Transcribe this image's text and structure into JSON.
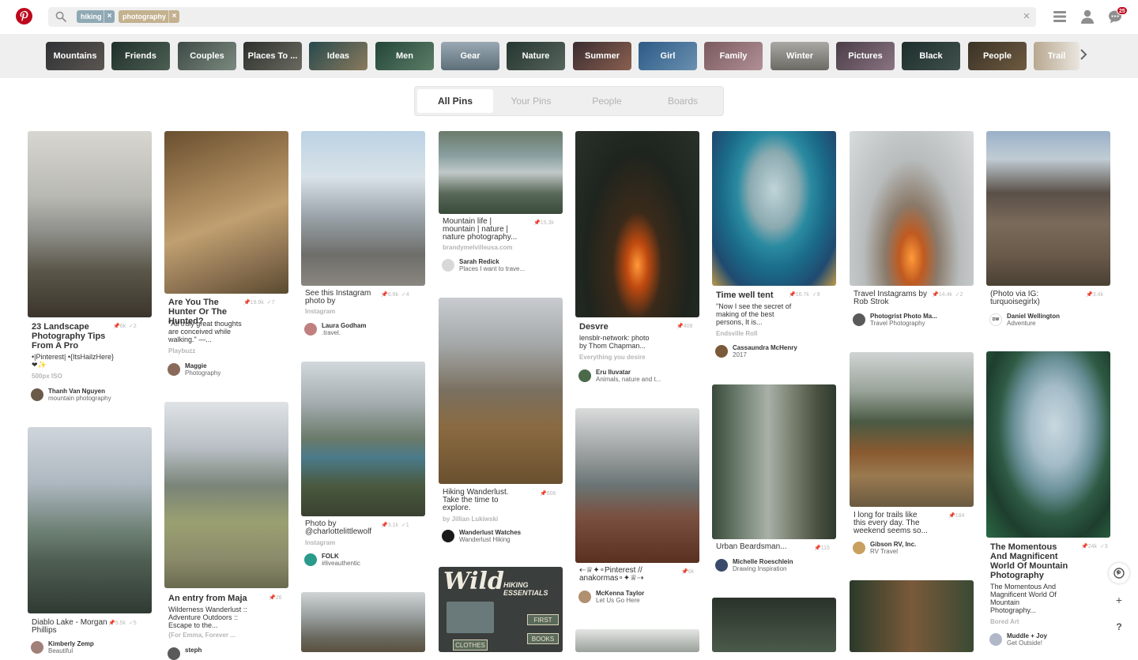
{
  "header": {
    "logo_icon": "pinterest-logo-icon",
    "search_chips": [
      {
        "label": "hiking",
        "color": "#8fa9b4"
      },
      {
        "label": "photography",
        "color": "#c3b18f"
      }
    ],
    "clear": "×",
    "remove": "×",
    "notification_count": "25"
  },
  "guides": [
    "Mountains",
    "Friends",
    "Couples",
    "Places To ...",
    "Ideas",
    "Men",
    "Gear",
    "Nature",
    "Summer",
    "Girl",
    "Family",
    "Winter",
    "Pictures",
    "Black",
    "People",
    "Trail"
  ],
  "tabs": [
    "All Pins",
    "Your Pins",
    "People",
    "Boards"
  ],
  "pins": [
    {
      "title": "23 Landscape Photography Tips From A Pro",
      "desc": "•|Pinterest| •{ItsHailzHere}❤✨",
      "source": "500px ISO",
      "saves": "6k",
      "likes": "2",
      "user": "Thanh Van Nguyen",
      "board": "mountain photography"
    },
    {
      "title": "Diablo Lake - Morgan Phillips",
      "saves": "5.5k",
      "likes": "5",
      "user": "Kimberly Zemp",
      "board": "Beautiful"
    },
    {
      "title": "Are You The Hunter Or The Hunted?",
      "desc": "\"All truly great thoughts are conceived while walking.\" —...",
      "source": "Playbuzz",
      "saves": "19.9k",
      "likes": "7",
      "user": "Maggie",
      "board": "Photography"
    },
    {
      "title": "An entry from Maja",
      "desc": "Wilderness Wanderlust :: Adventure Outdoors :: Escape to the...",
      "source": "{For Emma, Forever ...",
      "saves": "26",
      "user": "steph"
    },
    {
      "title": "See this Instagram photo by",
      "source": "Instagram",
      "saves": "6.6k",
      "likes": "4",
      "user": "Laura Godham",
      "board": ".travel."
    },
    {
      "title": "Photo by @charlottelittlewolf",
      "source": "Instagram",
      "saves": "3.1k",
      "likes": "1",
      "user": "FOLK",
      "board": "#liveauthentic"
    },
    {
      "title": "Mountain life | mountain | nature | nature photography...",
      "source": "brandymelvilleusa.com",
      "saves": "15.3k",
      "user": "Sarah Redick",
      "board": "Places I want to trave..."
    },
    {
      "title": "Hiking Wanderlust. Take the time to explore.",
      "source": "by Jillian Lukiwski",
      "saves": "606",
      "user": "Wanderlust Watches",
      "board": "Wanderlust Hiking"
    },
    {
      "title": "Desvre",
      "desc": "lensblr-network: photo by Thom Chapman...",
      "source": "Everything you desire",
      "saves": "408",
      "user": "Eru Iluvatar",
      "board": "Animals, nature and t..."
    },
    {
      "title": "⇠♕✦∘Pinterest // anakormas∘✦♕⇢",
      "saves": "6k",
      "user": "McKenna Taylor",
      "board": "Let Us Go Here"
    },
    {
      "title": "Time well tent",
      "desc": "\"Now I see the secret of making of the best persons, It is...",
      "source": "Endsville Roll",
      "saves": "16.7k",
      "likes": "9",
      "user": "Cassaundra McHenry",
      "board": "2017"
    },
    {
      "title": "Urban Beardsman...",
      "saves": "115",
      "user": "Michelle Roeschlein",
      "board": "Drawing Inspiration"
    },
    {
      "title": "Travel Instagrams by Rob Strok",
      "saves": "14.4k",
      "likes": "2",
      "user": "Photogrist Photo Ma...",
      "board": "Travel Photography"
    },
    {
      "title": "I long for trails like this every day. The weekend seems so...",
      "saves": "184",
      "user": "Gibson RV, Inc.",
      "board": "RV Travel"
    },
    {
      "title": "(Photo via IG: turquoisegirlx)",
      "saves": "3.4k",
      "user": "Daniel Wellington",
      "board": "Adventure",
      "avatar_text": "DW"
    },
    {
      "title": "The Momentous And Magnificent World Of Mountain Photography",
      "desc": "The Momentous And Magnificent World Of Mountain Photography...",
      "source": "Bored Art",
      "saves": "24k",
      "likes": "3",
      "user": "Muddle + Joy",
      "board": "Get Outside!"
    }
  ],
  "poster": {
    "line1": "Wild",
    "line2": "HIKING ESSENTIALS",
    "label_a": "FIRST",
    "label_b": "BOOKS",
    "label_c": "CLOTHES"
  },
  "fab": {
    "add": "+",
    "help": "?"
  }
}
